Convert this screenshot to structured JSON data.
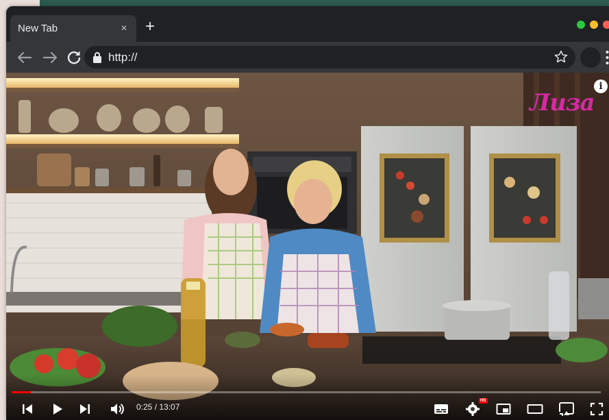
{
  "browser": {
    "tab": {
      "title": "New Tab",
      "close_glyph": "×"
    },
    "new_tab_glyph": "+",
    "address": {
      "url": "http://"
    }
  },
  "video": {
    "channel_logo": "Лиза",
    "info_glyph": "i",
    "current_time": "0:25",
    "duration": "13:07",
    "time_separator": " / ",
    "progress_fraction": 0.032,
    "hd_badge": "HD"
  },
  "colors": {
    "progress": "#ff0000",
    "logo": "#d62aa3",
    "tab_active": "#35363a",
    "chrome_dark": "#202124"
  },
  "icons": {
    "back": "arrow-left-icon",
    "forward": "arrow-right-icon",
    "reload": "reload-icon",
    "lock": "lock-icon",
    "bookmark": "star-icon",
    "menu": "kebab-menu-icon",
    "previous": "skip-previous-icon",
    "play": "play-icon",
    "next": "skip-next-icon",
    "volume": "volume-icon",
    "subtitles": "subtitles-icon",
    "settings": "gear-icon",
    "miniplayer": "miniplayer-icon",
    "theater": "theater-mode-icon",
    "cast": "cast-icon",
    "fullscreen": "fullscreen-icon"
  }
}
